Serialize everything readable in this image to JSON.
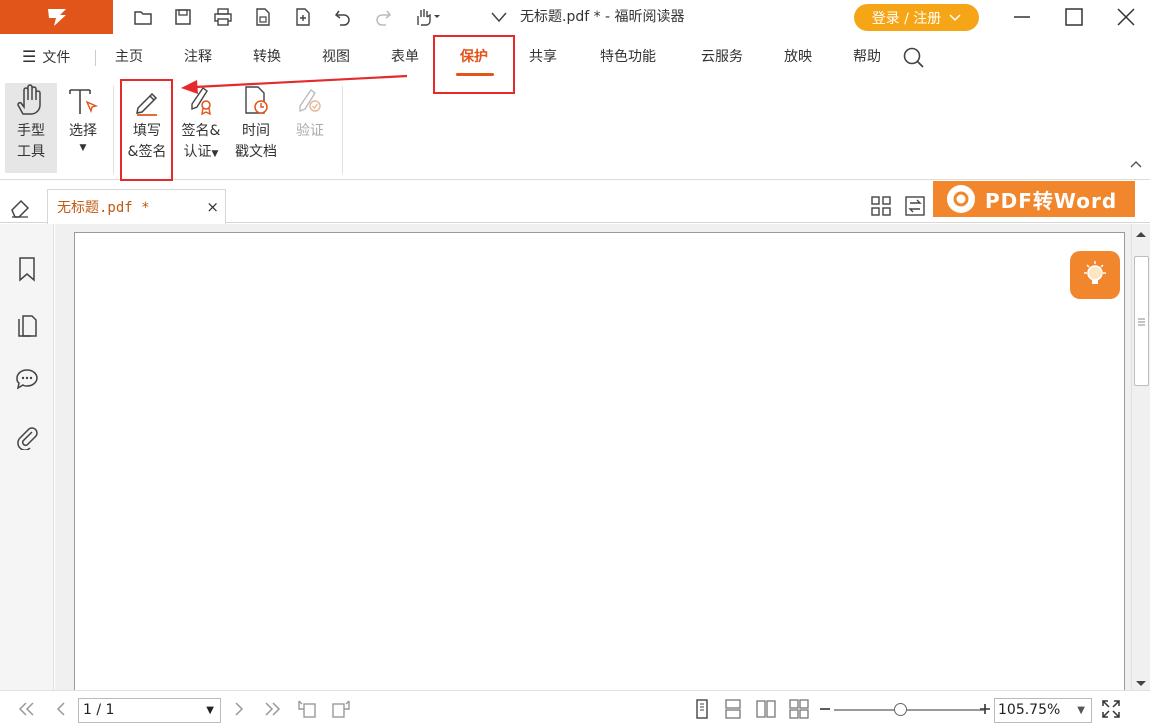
{
  "window": {
    "doc_title": "无标题.pdf * - 福昕阅读器",
    "login_label": "登录 / 注册"
  },
  "menu": {
    "file_label": "文件",
    "tabs": [
      "主页",
      "注释",
      "转换",
      "视图",
      "表单",
      "保护",
      "共享",
      "特色功能",
      "云服务",
      "放映",
      "帮助"
    ],
    "active_tab": "保护"
  },
  "ribbon": {
    "hand_tool": [
      "手型",
      "工具"
    ],
    "select": "选择",
    "fill_sign": [
      "填写",
      "&签名"
    ],
    "sign_cert": [
      "签名&",
      "认证"
    ],
    "timestamp": [
      "时间",
      "戳文档"
    ],
    "verify": "验证"
  },
  "doc_tab": {
    "name": "无标题.pdf *",
    "close": "×"
  },
  "promo": {
    "label": "PDF转Word"
  },
  "status": {
    "page": "1 / 1",
    "zoom": "105.75%",
    "zoom_fraction": 0.44
  },
  "colors": {
    "accent": "#e1541a",
    "login_bg": "#f5a516",
    "promo_bg": "#f1862d",
    "annotation_red": "#e42a2a"
  }
}
